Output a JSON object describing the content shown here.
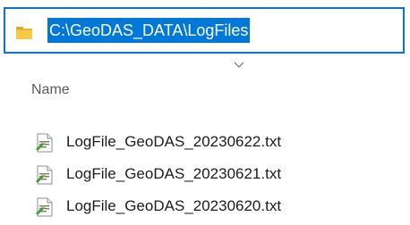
{
  "address_bar": {
    "path": "C:\\GeoDAS_DATA\\LogFiles",
    "icon": "folder-icon",
    "selection_color": "#0078d7",
    "border_color": "#0a74d6"
  },
  "columns": {
    "name_label": "Name",
    "sort_icon": "chevron-down-icon"
  },
  "files": [
    {
      "name": "LogFile_GeoDAS_20230622.txt",
      "icon": "text-file-icon"
    },
    {
      "name": "LogFile_GeoDAS_20230621.txt",
      "icon": "text-file-icon"
    },
    {
      "name": "LogFile_GeoDAS_20230620.txt",
      "icon": "text-file-icon"
    }
  ]
}
